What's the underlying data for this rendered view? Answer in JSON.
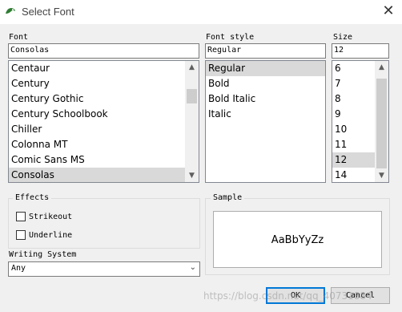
{
  "window": {
    "title": "Select Font",
    "close_glyph": "✕"
  },
  "font": {
    "label": "Font",
    "value": "Consolas",
    "items": [
      "Centaur",
      "Century",
      "Century Gothic",
      "Century Schoolbook",
      "Chiller",
      "Colonna MT",
      "Comic Sans MS",
      "Consolas"
    ],
    "selected_index": 7
  },
  "font_style": {
    "label": "Font style",
    "value": "Regular",
    "items": [
      "Regular",
      "Bold",
      "Bold Italic",
      "Italic"
    ],
    "selected_index": 0
  },
  "size": {
    "label": "Size",
    "value": "12",
    "items": [
      "6",
      "7",
      "8",
      "9",
      "10",
      "11",
      "12",
      "14"
    ],
    "selected_index": 6
  },
  "effects": {
    "label": "Effects",
    "strikeout": "Strikeout",
    "underline": "Underline",
    "strikeout_checked": false,
    "underline_checked": false
  },
  "sample": {
    "label": "Sample",
    "text": "AaBbYyZz"
  },
  "writing_system": {
    "label": "Writing System",
    "value": "Any"
  },
  "buttons": {
    "ok": "OK",
    "cancel": "Cancel"
  },
  "watermark": "https://blog.csdn.net/qq_40731884",
  "colors": {
    "selection": "#d9d9d9",
    "default_button_border": "#0078d7",
    "background": "#f0f0f0"
  }
}
